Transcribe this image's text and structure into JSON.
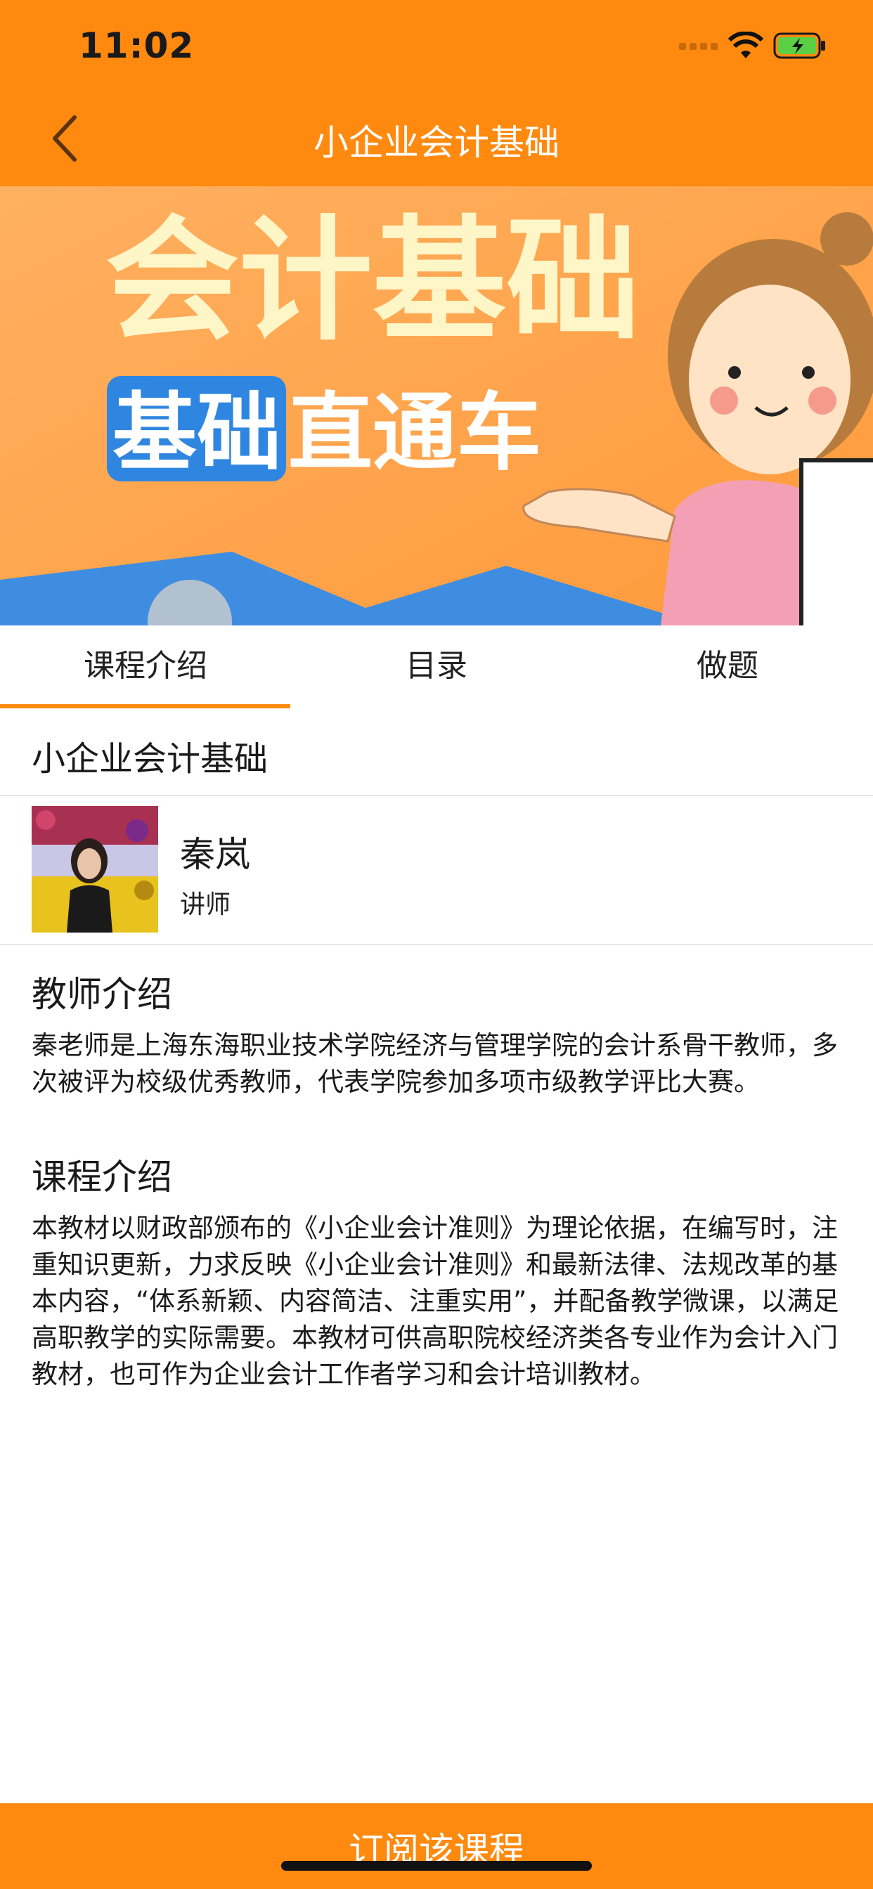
{
  "status_bar": {
    "time": "11:02"
  },
  "nav": {
    "title": "小企业会计基础"
  },
  "banner": {
    "title": "会计基础",
    "badge": "基础",
    "subtitle": "直通车"
  },
  "tabs": [
    {
      "label": "课程介绍",
      "active": true
    },
    {
      "label": "目录",
      "active": false
    },
    {
      "label": "做题",
      "active": false
    }
  ],
  "course": {
    "title": "小企业会计基础"
  },
  "teacher": {
    "name": "秦岚",
    "role": "讲师"
  },
  "teacher_intro": {
    "heading": "教师介绍",
    "text": "秦老师是上海东海职业技术学院经济与管理学院的会计系骨干教师，多次被评为校级优秀教师，代表学院参加多项市级教学评比大赛。"
  },
  "course_intro": {
    "heading": "课程介绍",
    "text": "本教材以财政部颁布的《小企业会计准则》为理论依据，在编写时，注重知识更新，力求反映《小企业会计准则》和最新法律、法规改革的基本内容，“体系新颖、内容简洁、注重实用”，并配备教学微课，以满足高职教学的实际需要。本教材可供高职院校经济类各专业作为会计入门教材，也可作为企业会计工作者学习和会计培训教材。"
  },
  "actions": {
    "subscribe_label": "订阅该课程"
  },
  "colors": {
    "accent": "#FF8A0F",
    "battery": "#5BD045"
  }
}
